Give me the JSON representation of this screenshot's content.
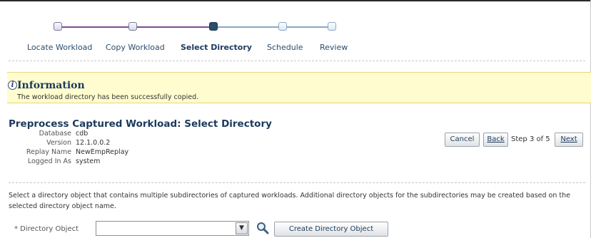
{
  "train": {
    "steps": [
      {
        "label": "Locate Workload",
        "state": "visited"
      },
      {
        "label": "Copy Workload",
        "state": "visited"
      },
      {
        "label": "Select Directory",
        "state": "current"
      },
      {
        "label": "Schedule",
        "state": "future"
      },
      {
        "label": "Review",
        "state": "future"
      }
    ]
  },
  "info": {
    "icon": "info-icon",
    "title": "Information",
    "message": "The workload directory has been successfully copied."
  },
  "page": {
    "title": "Preprocess Captured Workload: Select Directory",
    "details": [
      {
        "label": "Database",
        "value": "cdb"
      },
      {
        "label": "Version",
        "value": "12.1.0.0.2"
      },
      {
        "label": "Replay Name",
        "value": "NewEmpReplay"
      },
      {
        "label": "Logged In As",
        "value": "system"
      }
    ]
  },
  "nav": {
    "cancel_label": "Cancel",
    "back_label": "Back",
    "step_text": "Step 3 of 5",
    "next_label": "Next"
  },
  "help_text": "Select a directory object that contains multiple subdirectories of captured workloads. Additional directory objects for the subdirectories may be created based on the selected directory object name.",
  "form": {
    "directory_label": "* Directory Object",
    "directory_value": "",
    "create_button_label": "Create Directory Object",
    "search_icon": "search-icon",
    "dropdown_icon": "chevron-down-icon"
  },
  "colors": {
    "accent": "#1c3a5c",
    "visited_line": "#7d4c8f",
    "info_background": "#fffccf"
  }
}
